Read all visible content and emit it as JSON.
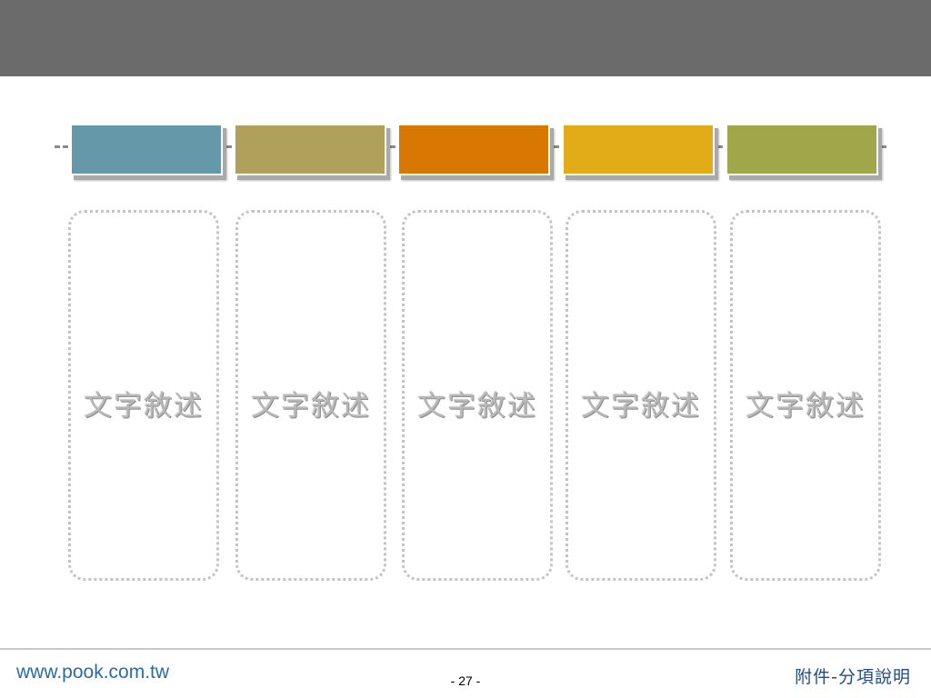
{
  "header_colors": [
    "#6599aa",
    "#afa05b",
    "#d87702",
    "#e2ac18",
    "#a0a64a"
  ],
  "panels": [
    {
      "text": "文字敘述"
    },
    {
      "text": "文字敘述"
    },
    {
      "text": "文字敘述"
    },
    {
      "text": "文字敘述"
    },
    {
      "text": "文字敘述"
    }
  ],
  "footer": {
    "url": "www.pook.com.tw",
    "page": "- 27 -",
    "title": "附件-分項說明"
  }
}
